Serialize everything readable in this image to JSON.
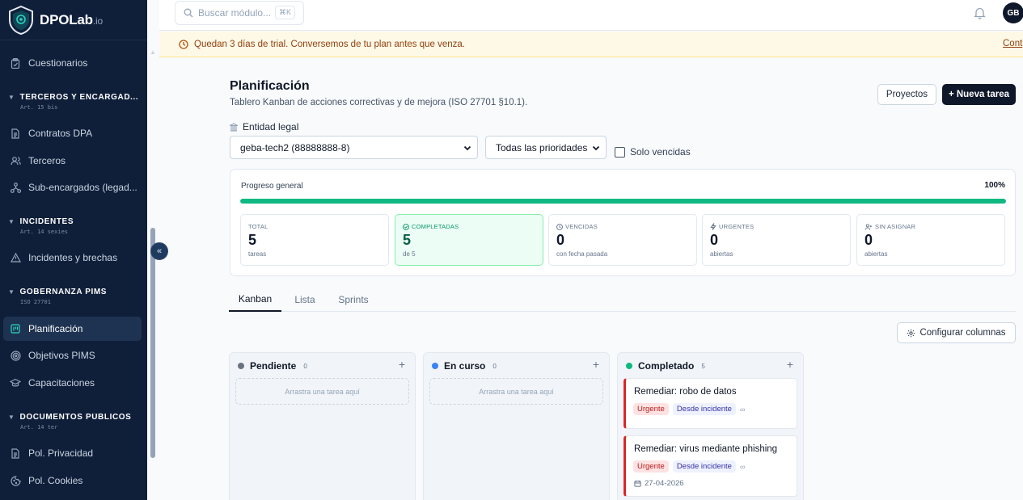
{
  "app": {
    "name": "DPOLab",
    "suffix": ".io"
  },
  "sidebar": {
    "items": [
      {
        "label": "Cuestionarios",
        "icon": "clipboard-icon"
      },
      {
        "label": "Contratos DPA",
        "icon": "file-text-icon"
      },
      {
        "label": "Terceros",
        "icon": "users-icon"
      },
      {
        "label": "Sub-encargados (legad...",
        "icon": "network-icon"
      },
      {
        "label": "Incidentes y brechas",
        "icon": "alert-triangle-icon"
      },
      {
        "label": "Planificación",
        "icon": "kanban-icon",
        "active": true
      },
      {
        "label": "Objetivos PIMS",
        "icon": "target-icon"
      },
      {
        "label": "Capacitaciones",
        "icon": "graduation-cap-icon"
      },
      {
        "label": "Pol. Privacidad",
        "icon": "file-text-icon"
      },
      {
        "label": "Pol. Cookies",
        "icon": "cookie-icon"
      }
    ],
    "sections": [
      {
        "title": "TERCEROS Y ENCARGAD...",
        "sub": "Art. 15 bis"
      },
      {
        "title": "INCIDENTES",
        "sub": "Art. 14 sexies"
      },
      {
        "title": "GOBERNANZA PIMS",
        "sub": "ISO 27701"
      },
      {
        "title": "DOCUMENTOS PÚBLICOS",
        "sub": "Art. 14 ter"
      }
    ],
    "collapse_glyph": "«"
  },
  "topbar": {
    "search_placeholder": "Buscar módulo...",
    "search_shortcut": "⌘K",
    "avatar_initials": "GB"
  },
  "trial": {
    "message": "Quedan 3 días de trial. Conversemos de tu plan antes que venza.",
    "link": "Cont"
  },
  "page": {
    "title": "Planificación",
    "subtitle": "Tablero Kanban de acciones correctivas y de mejora (ISO 27701 §10.1).",
    "projects_button": "Proyectos",
    "new_task_button": "+ Nueva tarea"
  },
  "filters": {
    "entity_label": "Entidad legal",
    "entity_value": "geba-tech2 (88888888-8)",
    "priority_value": "Todas las prioridades",
    "overdue_label": "Solo vencidas"
  },
  "progress": {
    "label": "Progreso general",
    "percent_text": "100%",
    "fraction": 1.0,
    "stats": [
      {
        "label": "TOTAL",
        "value": "5",
        "sub": "tareas",
        "icon": ""
      },
      {
        "label": "COMPLETADAS",
        "value": "5",
        "sub": "de 5",
        "icon": "check-circle-icon",
        "highlight": true
      },
      {
        "label": "VENCIDAS",
        "value": "0",
        "sub": "con fecha pasada",
        "icon": "clock-icon"
      },
      {
        "label": "URGENTES",
        "value": "0",
        "sub": "abiertas",
        "icon": "zap-icon"
      },
      {
        "label": "SIN ASIGNAR",
        "value": "0",
        "sub": "abiertas",
        "icon": "user-plus-icon"
      }
    ]
  },
  "tabs": [
    "Kanban",
    "Lista",
    "Sprints"
  ],
  "configure_columns_button": "Configurar columnas",
  "board": {
    "drop_hint": "Arrastra una tarea aquí",
    "columns": [
      {
        "name": "Pendiente",
        "count": "0",
        "color": "#6b7280"
      },
      {
        "name": "En curso",
        "count": "0",
        "color": "#3b82f6"
      },
      {
        "name": "Completado",
        "count": "5",
        "color": "#10b981"
      }
    ],
    "cards": [
      {
        "title": "Remediar: robo de datos",
        "priority": "Urgente",
        "origin": "Desde incidente",
        "due": ""
      },
      {
        "title": "Remediar: virus mediante phishing",
        "priority": "Urgente",
        "origin": "Desde incidente",
        "due": "27-04-2026"
      }
    ]
  },
  "colors": {
    "sidebar_bg": "#0f1f3a",
    "accent": "#10b981",
    "urgent": "#dc2626",
    "trial_bg": "#fef9e7"
  }
}
